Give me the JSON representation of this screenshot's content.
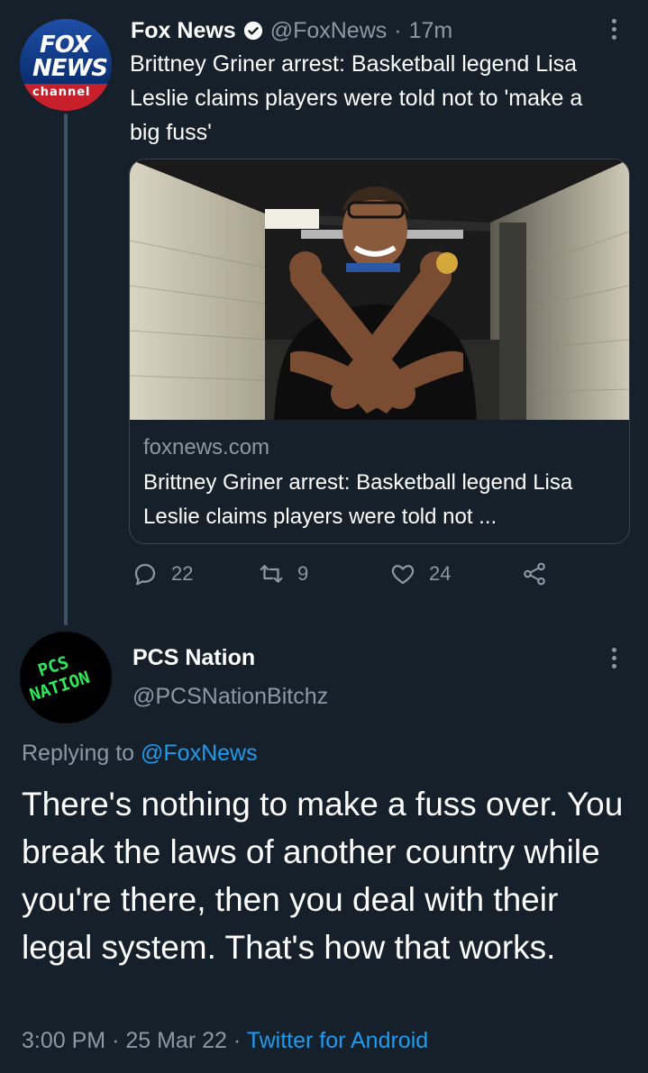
{
  "tweet1": {
    "name": "Fox News",
    "handle": "@FoxNews",
    "separator": "·",
    "time": "17m",
    "text": "Brittney Griner arrest: Basketball legend Lisa Leslie claims players were told not to 'make a big fuss'",
    "avatar": {
      "line1": "FOX",
      "line2": "NEWS",
      "line3": "channel"
    },
    "card": {
      "domain": "foxnews.com",
      "title": "Brittney Griner arrest: Basketball legend Lisa Leslie claims players were told not ..."
    },
    "actions": {
      "replies": "22",
      "retweets": "9",
      "likes": "24"
    }
  },
  "tweet2": {
    "name": "PCS Nation",
    "handle": "@PCSNationBitchz",
    "avatar": {
      "line1": "PCS",
      "line2": "NATION"
    },
    "replying_prefix": "Replying to",
    "replying_to": "@FoxNews",
    "text": "There's nothing to make a fuss over. You break the laws of another country while you're there, then you deal with their legal system. That's how that works.",
    "time": "3:00 PM",
    "sep": "·",
    "date": "25 Mar 22",
    "sep2": "·",
    "source": "Twitter for Android"
  },
  "colors": {
    "background": "#15202b",
    "secondary_text": "#8b98a5",
    "link": "#1d9bf0",
    "border": "#38444d"
  }
}
